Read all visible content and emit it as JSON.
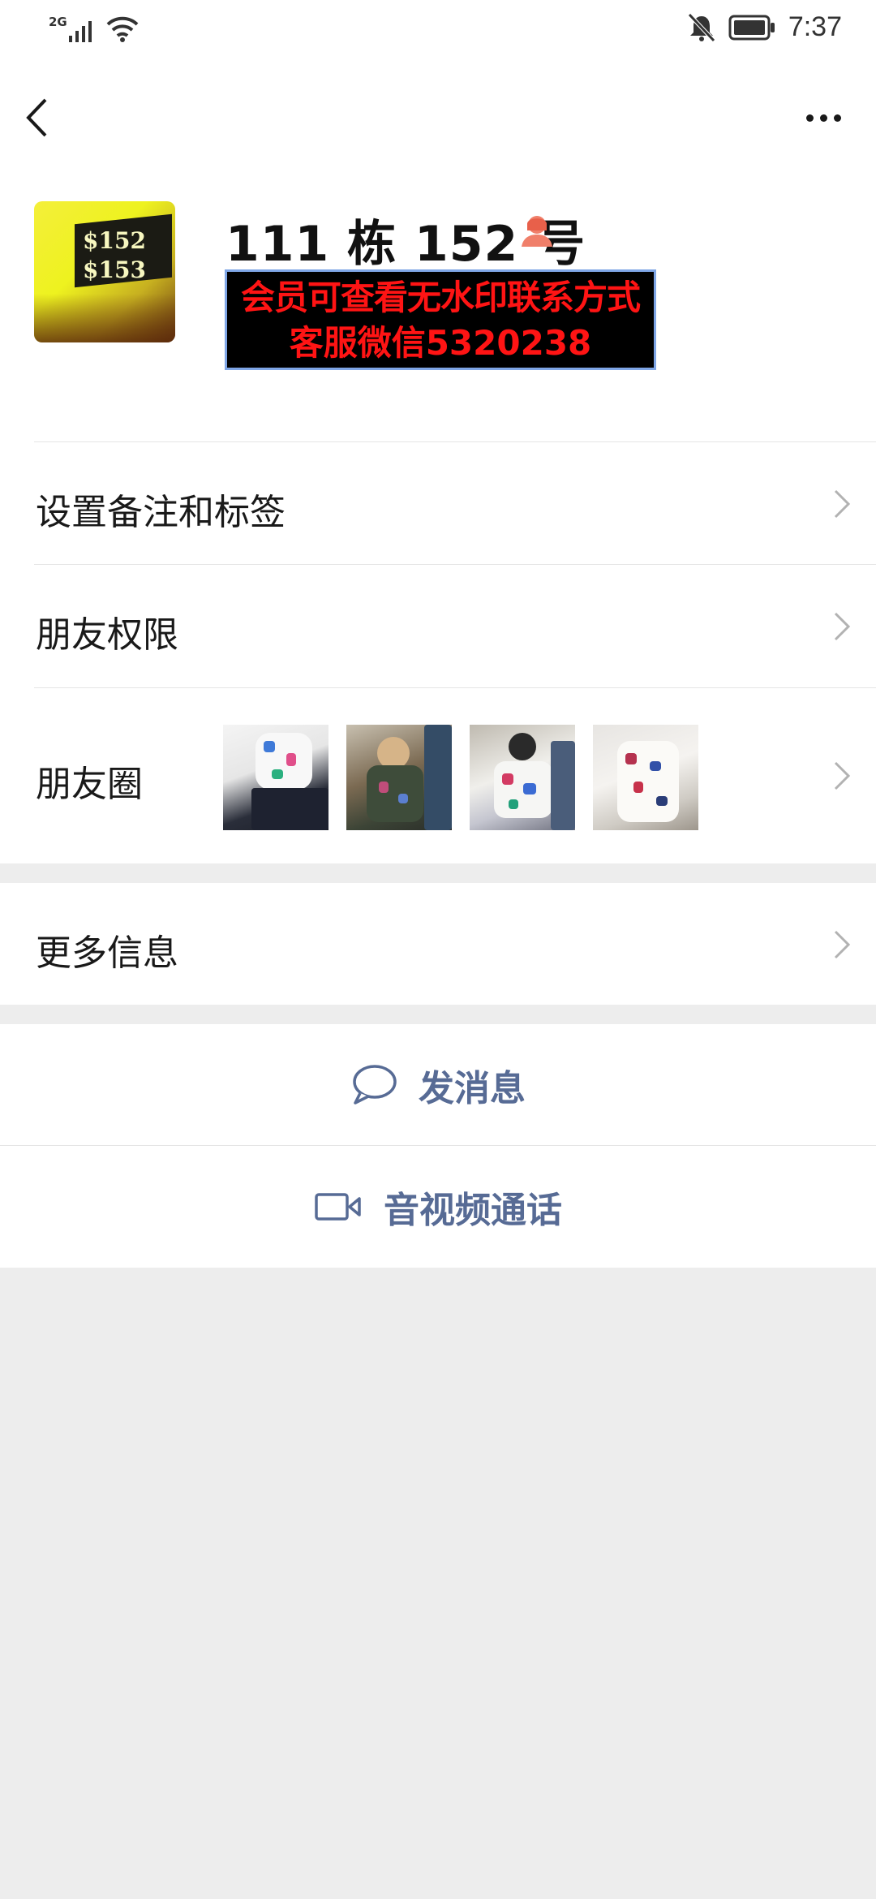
{
  "status_bar": {
    "network": "2G",
    "time": "7:37",
    "icons": [
      "signal-icon",
      "wifi-icon",
      "mute-bell-icon",
      "battery-icon"
    ]
  },
  "nav": {
    "back_icon": "chevron-left-icon",
    "more_icon": "more-dots-icon"
  },
  "profile": {
    "name": "111 栋 152 号",
    "gender_icon": "female-icon",
    "avatar_text": [
      "$152",
      "$153"
    ],
    "promo_line1": "会员可查看无水印联系方式",
    "promo_line2": "客服微信5320238"
  },
  "menu": {
    "remark": "设置备注和标签",
    "permissions": "朋友权限",
    "moments": "朋友圈",
    "more_info": "更多信息"
  },
  "actions": {
    "message": "发消息",
    "call": "音视频通话"
  },
  "colors": {
    "link_blue": "#576b95",
    "promo_red": "#ff1414",
    "background": "#ededed"
  }
}
